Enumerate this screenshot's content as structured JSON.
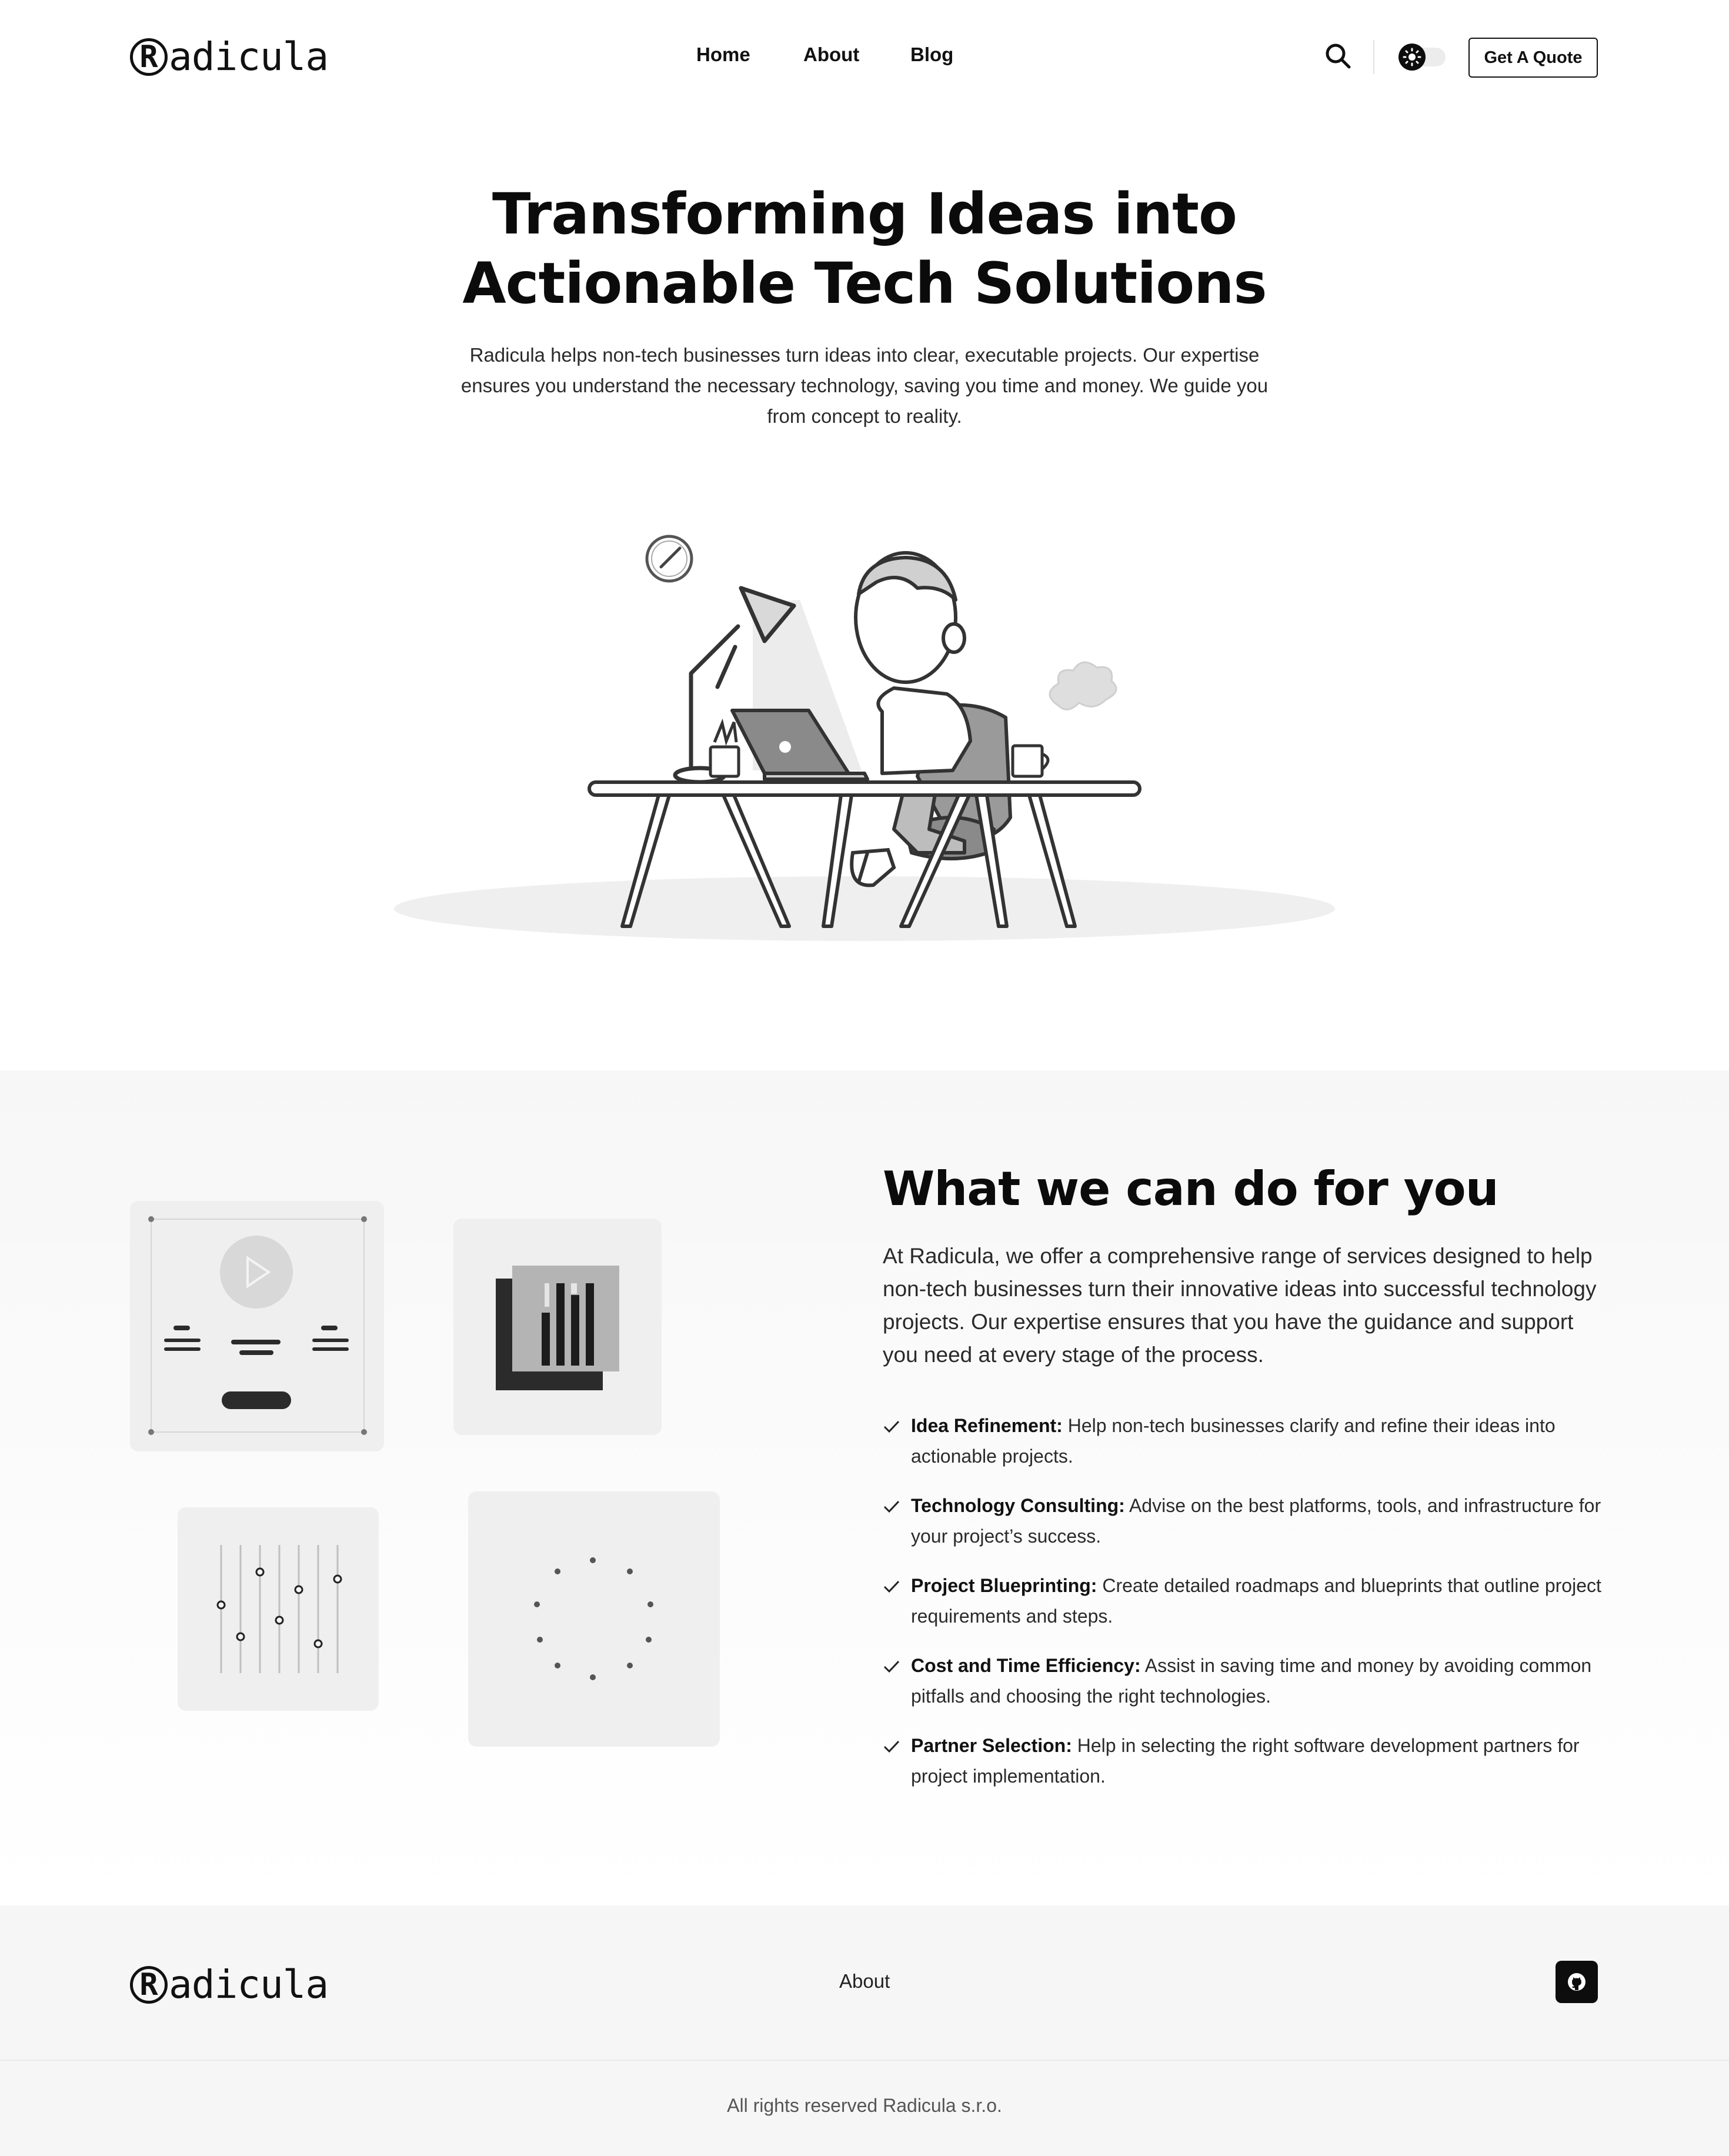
{
  "header": {
    "logo_letter": "R",
    "logo_text": "adicula",
    "nav": [
      "Home",
      "About",
      "Blog"
    ],
    "icons": [
      "search-icon",
      "sun-icon"
    ],
    "theme_toggle": "light",
    "cta_label": "Get A Quote"
  },
  "hero": {
    "title_line1": "Transforming Ideas into",
    "title_line2": "Actionable Tech Solutions",
    "subtitle": "Radicula helps non-tech businesses turn ideas into clear, executable projects. Our expertise ensures you understand the necessary technology, saving you time and money. We guide you from concept to reality."
  },
  "services": {
    "title": "What we can do for you",
    "intro": "At Radicula, we offer a comprehensive range of services designed to help non-tech businesses turn their innovative ideas into successful technology projects. Our expertise ensures that you have the guidance and support you need at every stage of the process.",
    "items": [
      {
        "title": "Idea Refinement:",
        "text": " Help non-tech businesses clarify and refine their ideas into actionable projects."
      },
      {
        "title": "Technology Consulting:",
        "text": " Advise on the best platforms, tools, and infrastructure for your project’s success."
      },
      {
        "title": "Project Blueprinting:",
        "text": " Create detailed roadmaps and blueprints that outline project requirements and steps."
      },
      {
        "title": "Cost and Time Efficiency:",
        "text": " Assist in saving time and money by avoiding common pitfalls and choosing the right technologies."
      },
      {
        "title": "Partner Selection:",
        "text": " Help in selecting the right software development partners for project implementation."
      }
    ],
    "card_icons": [
      "video-player-card",
      "bar-chart-card",
      "sliders-card",
      "loading-spinner-card"
    ]
  },
  "footer": {
    "logo_letter": "R",
    "logo_text": "adicula",
    "link": "About",
    "icon": "github-icon",
    "rights": "All rights reserved Radicula s.r.o."
  },
  "colors": {
    "text": "#111111",
    "section_bg": "#f7f7f7",
    "footer_bg": "#f6f6f6",
    "card_bg": "#efefef"
  }
}
